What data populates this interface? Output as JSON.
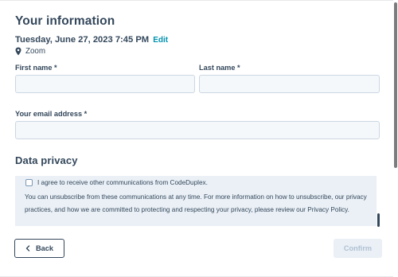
{
  "header": {
    "title": "Your information",
    "datetime": "Tuesday, June 27, 2023 7:45 PM",
    "edit_label": "Edit",
    "location": "Zoom"
  },
  "form": {
    "first_name_label": "First name *",
    "first_name_value": "",
    "last_name_label": "Last name *",
    "last_name_value": "",
    "email_label": "Your email address *",
    "email_value": ""
  },
  "privacy": {
    "title": "Data privacy",
    "consent_label": "I agree to receive other communications from CodeDuplex.",
    "consent_checked": false,
    "notice": "You can unsubscribe from these communications at any time. For more information on how to unsubscribe, our privacy practices, and how we are committed to protecting and respecting your privacy, please review our Privacy Policy."
  },
  "actions": {
    "back_label": "Back",
    "confirm_label": "Confirm"
  },
  "icons": {
    "location": "map-pin-icon",
    "back": "chevron-left-icon"
  },
  "colors": {
    "text": "#33475b",
    "link": "#0091ae",
    "input_bg": "#f5f8fa",
    "input_border": "#cbd6e2",
    "privacy_bg": "#eaf0f6",
    "disabled_text": "#b0c1d4"
  }
}
